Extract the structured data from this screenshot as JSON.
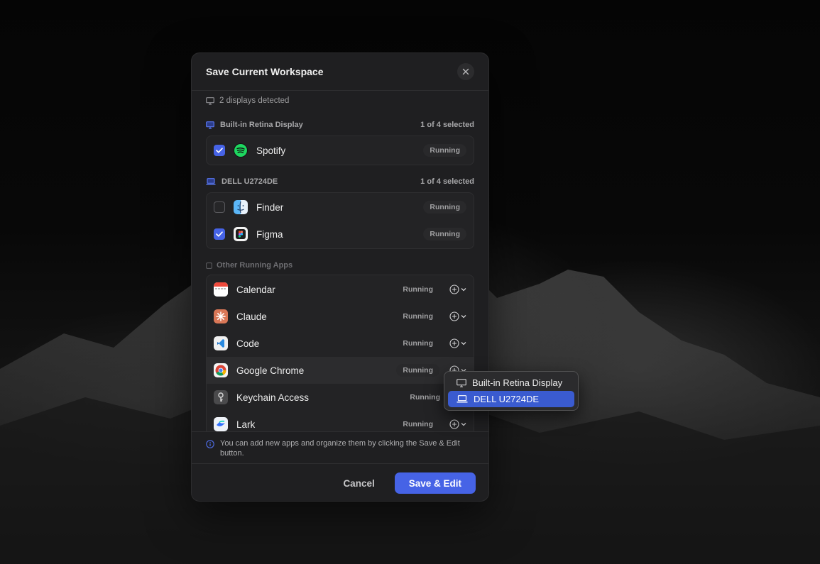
{
  "dialog": {
    "title": "Save Current Workspace",
    "displays_detected": "2 displays detected"
  },
  "sections": [
    {
      "name": "Built-in Retina Display",
      "count": "1 of 4 selected",
      "apps": [
        {
          "name": "Spotify",
          "status": "Running",
          "checked": true,
          "icon": "spotify-icon"
        }
      ]
    },
    {
      "name": "DELL U2724DE",
      "count": "1 of 4 selected",
      "apps": [
        {
          "name": "Finder",
          "status": "Running",
          "checked": false,
          "icon": "finder-icon"
        },
        {
          "name": "Figma",
          "status": "Running",
          "checked": true,
          "icon": "figma-icon"
        }
      ]
    }
  ],
  "other": {
    "title": "Other Running Apps",
    "apps": [
      {
        "name": "Calendar",
        "status": "Running",
        "icon": "calendar-icon"
      },
      {
        "name": "Claude",
        "status": "Running",
        "icon": "claude-icon"
      },
      {
        "name": "Code",
        "status": "Running",
        "icon": "vscode-icon"
      },
      {
        "name": "Google Chrome",
        "status": "Running",
        "icon": "chrome-icon"
      },
      {
        "name": "Keychain Access",
        "status": "Running",
        "icon": "keychain-icon"
      },
      {
        "name": "Lark",
        "status": "Running",
        "icon": "lark-icon"
      }
    ]
  },
  "info": {
    "text": "You can add new apps and organize them by clicking the Save & Edit button."
  },
  "footer": {
    "cancel_label": "Cancel",
    "save_label": "Save & Edit"
  },
  "popup": {
    "options": [
      {
        "label": "Built-in Retina Display",
        "selected": false
      },
      {
        "label": "DELL U2724DE",
        "selected": true
      }
    ]
  },
  "colors": {
    "accent": "#4663e6",
    "dialog_bg": "#1f1f21",
    "selected_option": "#3a5bd0"
  }
}
